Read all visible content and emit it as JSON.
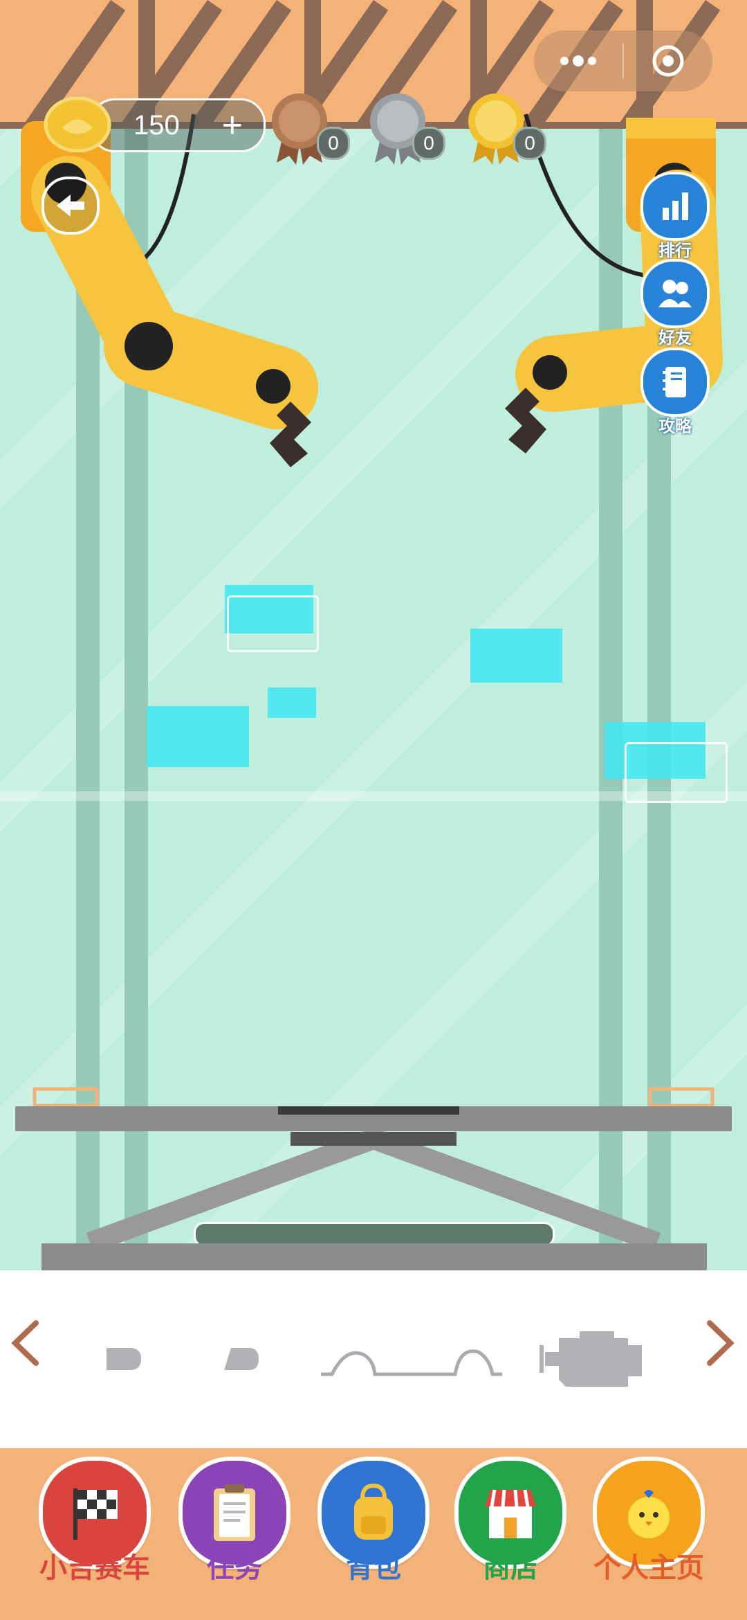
{
  "capsule": {
    "more_icon": "more-dots-icon",
    "close_icon": "target-circle-icon"
  },
  "coins": {
    "value": "150",
    "plus": "+"
  },
  "medals": [
    {
      "type": "bronze",
      "count": "0",
      "color": "#b27a52"
    },
    {
      "type": "silver",
      "count": "0",
      "color": "#9aa0a6"
    },
    {
      "type": "gold",
      "count": "0",
      "color": "#f2c230"
    }
  ],
  "side_buttons": [
    {
      "label": "排行",
      "icon": "bar-chart-icon"
    },
    {
      "label": "好友",
      "icon": "friends-icon"
    },
    {
      "label": "攻略",
      "icon": "guide-book-icon"
    }
  ],
  "parts": [
    "part-small-round",
    "part-small-wedge",
    "part-wheel-arch-bar",
    "part-engine"
  ],
  "nav": [
    {
      "label": "小吉赛车",
      "color": "#d9443f",
      "label_color": "#d9443f",
      "icon": "checkered-flag-icon"
    },
    {
      "label": "任务",
      "color": "#8a44b8",
      "label_color": "#8a44b8",
      "icon": "clipboard-icon"
    },
    {
      "label": "背包",
      "color": "#2f74d2",
      "label_color": "#2f74d2",
      "icon": "backpack-icon"
    },
    {
      "label": "商店",
      "color": "#22a54a",
      "label_color": "#22a54a",
      "icon": "shop-icon"
    },
    {
      "label": "个人主页",
      "color": "#f5a31a",
      "label_color": "#e25d2a",
      "icon": "chick-avatar-icon"
    }
  ]
}
